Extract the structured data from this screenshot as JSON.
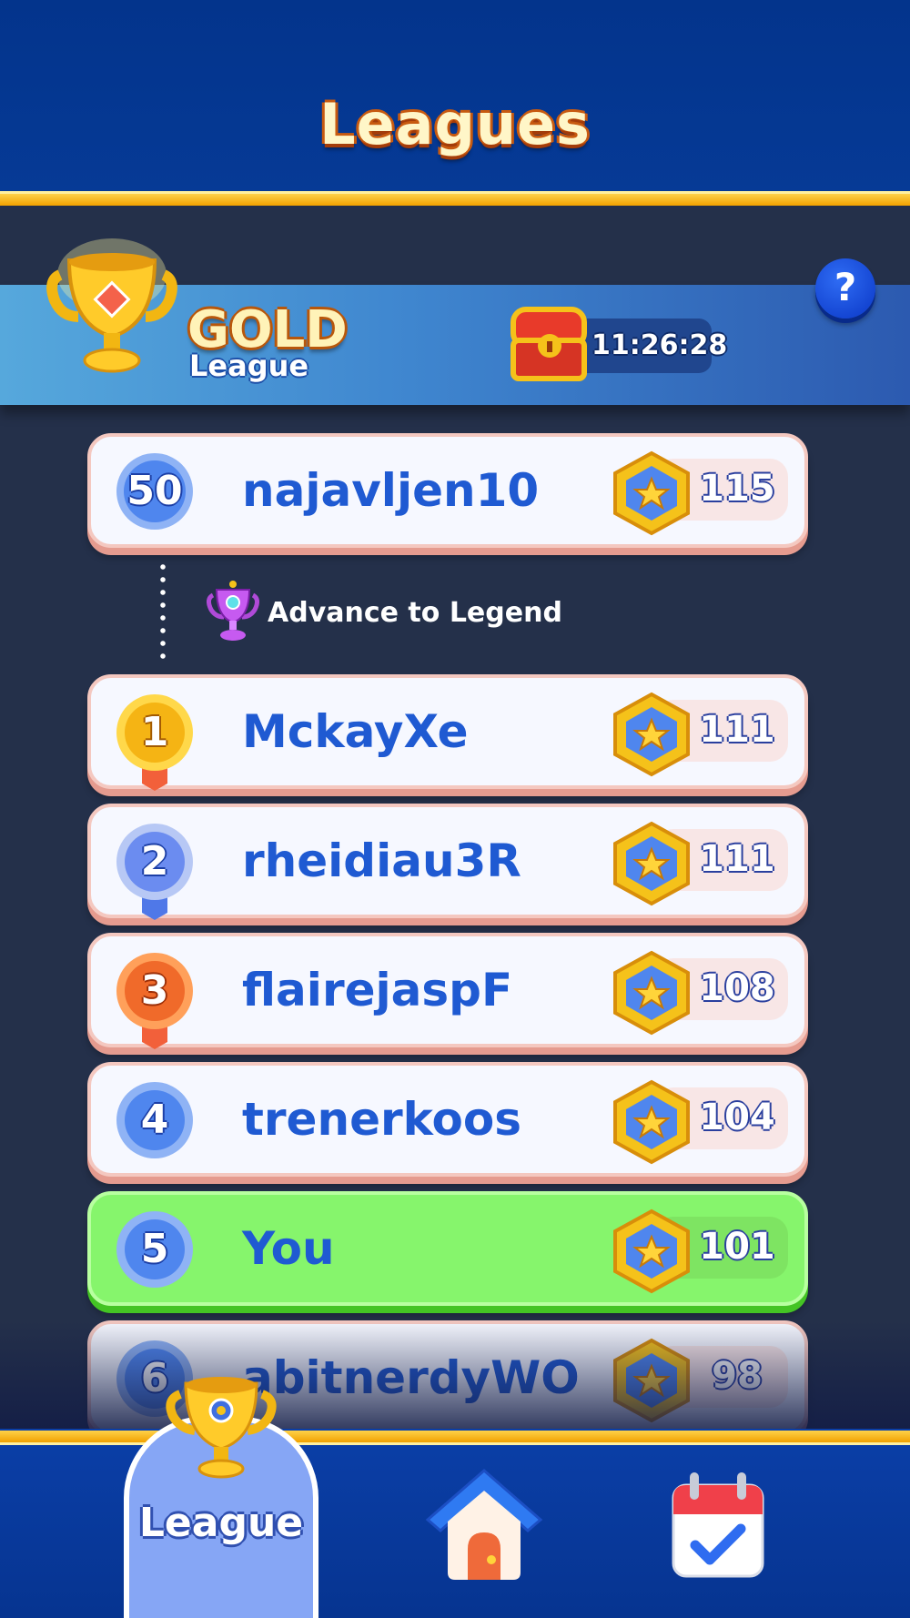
{
  "header": {
    "title": "Leagues"
  },
  "league": {
    "name": "GOLD",
    "subtitle": "League",
    "timer": "11:26:28",
    "help_label": "?"
  },
  "advance": {
    "text": "Advance to Legend"
  },
  "top_row": {
    "rank": "50",
    "name": "najavljen10",
    "score": "115"
  },
  "rows": [
    {
      "rank": "1",
      "name": "MckayXe",
      "score": "111",
      "medal": "gold"
    },
    {
      "rank": "2",
      "name": "rheidiau3R",
      "score": "111",
      "medal": "silver"
    },
    {
      "rank": "3",
      "name": "flairejaspF",
      "score": "108",
      "medal": "bronze"
    },
    {
      "rank": "4",
      "name": "trenerkoos",
      "score": "104",
      "medal": "none"
    },
    {
      "rank": "5",
      "name": "You",
      "score": "101",
      "medal": "none",
      "is_me": true
    },
    {
      "rank": "6",
      "name": "abitnerdyWO",
      "score": "98",
      "medal": "none"
    }
  ],
  "nav": {
    "items": [
      {
        "label": "League",
        "icon": "trophy-icon",
        "active": true
      },
      {
        "label": "",
        "icon": "home-icon",
        "active": false
      },
      {
        "label": "",
        "icon": "calendar-check-icon",
        "active": false
      }
    ]
  },
  "colors": {
    "accent_gold": "#f2a100",
    "name_blue": "#1f5ad2",
    "me_green": "#86f56c"
  }
}
